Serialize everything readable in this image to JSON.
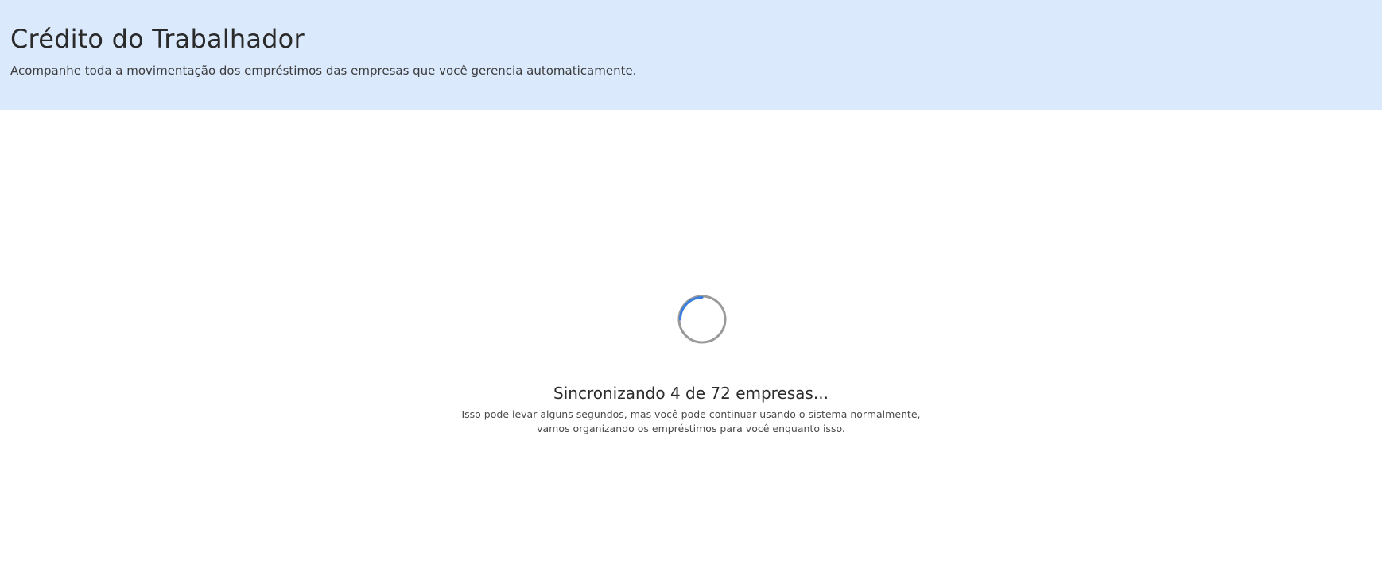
{
  "header": {
    "title": "Crédito do Trabalhador",
    "subtitle": "Acompanhe toda a movimentação dos empréstimos das empresas que você gerencia automaticamente.",
    "background_color": "#dbe9fd"
  },
  "sync": {
    "status": "Sincronizando 4 de 72 empresas...",
    "synced_count": 4,
    "total_count": 72,
    "hint_line_1": "Isso pode levar alguns segundos, mas você pode continuar usando o sistema normalmente,",
    "hint_line_2": "vamos organizando os empréstimos para você enquanto isso.",
    "spinner": {
      "icon": "loading-spinner-icon",
      "accent_color": "#3b7ddd",
      "track_color": "#9a9a9a"
    }
  }
}
